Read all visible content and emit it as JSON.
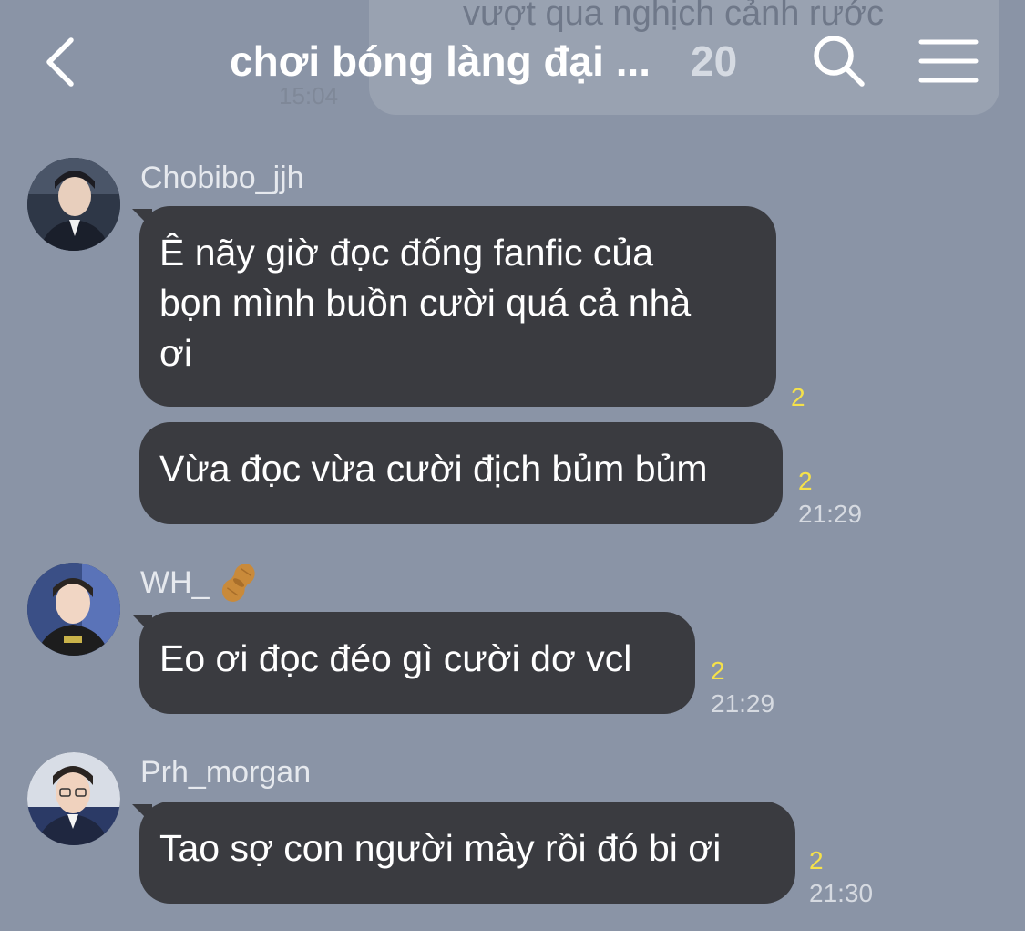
{
  "header": {
    "title": "chơi bóng làng đại ...",
    "member_count": "20"
  },
  "background_preview": {
    "text": "vượt qua nghịch cảnh rước",
    "time": "15:04"
  },
  "colors": {
    "background": "#8a94a6",
    "bubble": "#3a3b40",
    "unread": "#f5e14a"
  },
  "icons": {
    "back": "chevron-left-icon",
    "search": "search-icon",
    "menu": "hamburger-menu-icon",
    "emoji": "peanut-emoji-icon"
  },
  "messages": [
    {
      "sender": "Chobibo_jjh",
      "bubbles": [
        {
          "text": "Ê nãy giờ đọc đống fanfic của\nbọn mình buồn cười quá cả nhà\nơi",
          "unread": "2",
          "time": ""
        },
        {
          "text": "Vừa đọc vừa cười địch bủm bủm",
          "unread": "2",
          "time": "21:29"
        }
      ]
    },
    {
      "sender": "WH_",
      "bubbles": [
        {
          "text": "Eo ơi đọc đéo gì cười dơ vcl",
          "unread": "2",
          "time": "21:29"
        }
      ]
    },
    {
      "sender": "Prh_morgan",
      "bubbles": [
        {
          "text": "Tao sợ con người mày rồi đó bi ơi",
          "unread": "2",
          "time": "21:30"
        }
      ]
    }
  ]
}
